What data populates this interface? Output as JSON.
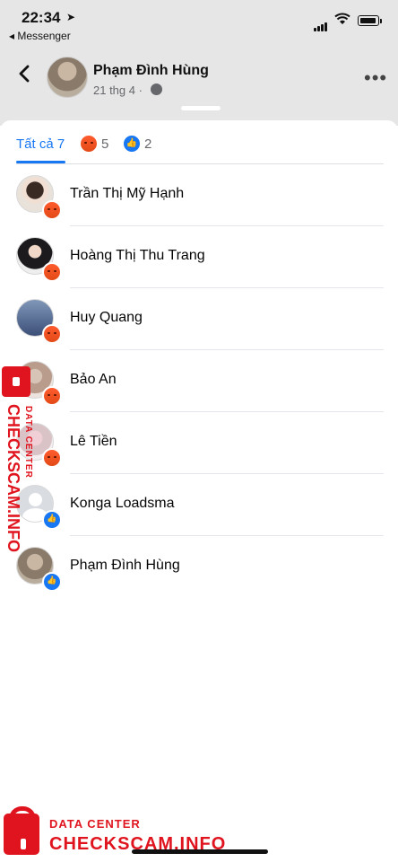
{
  "status_bar": {
    "time": "22:34",
    "location_arrow": "➤",
    "back_app": "◂ Messenger"
  },
  "post": {
    "author": "Phạm Đình Hùng",
    "date": "21 thg 4 ·",
    "more": "•••"
  },
  "tabs": [
    {
      "label": "Tất cả 7",
      "reaction": null
    },
    {
      "label": "5",
      "reaction": "angry"
    },
    {
      "label": "2",
      "reaction": "like"
    }
  ],
  "reactors": [
    {
      "name": "Trần Thị Mỹ Hạnh",
      "reaction": "angry"
    },
    {
      "name": "Hoàng Thị Thu Trang",
      "reaction": "angry"
    },
    {
      "name": "Huy Quang",
      "reaction": "angry"
    },
    {
      "name": "Bảo An",
      "reaction": "angry"
    },
    {
      "name": "Lê Tiền",
      "reaction": "angry"
    },
    {
      "name": "Konga Loadsma",
      "reaction": "like"
    },
    {
      "name": "Phạm Đình Hùng",
      "reaction": "like"
    }
  ],
  "watermark": {
    "line1": "DATA CENTER",
    "line2": "CHECKSCAM.INFO"
  },
  "colors": {
    "accent": "#1877f2",
    "angry": "#f0511f",
    "watermark": "#e0141e"
  }
}
